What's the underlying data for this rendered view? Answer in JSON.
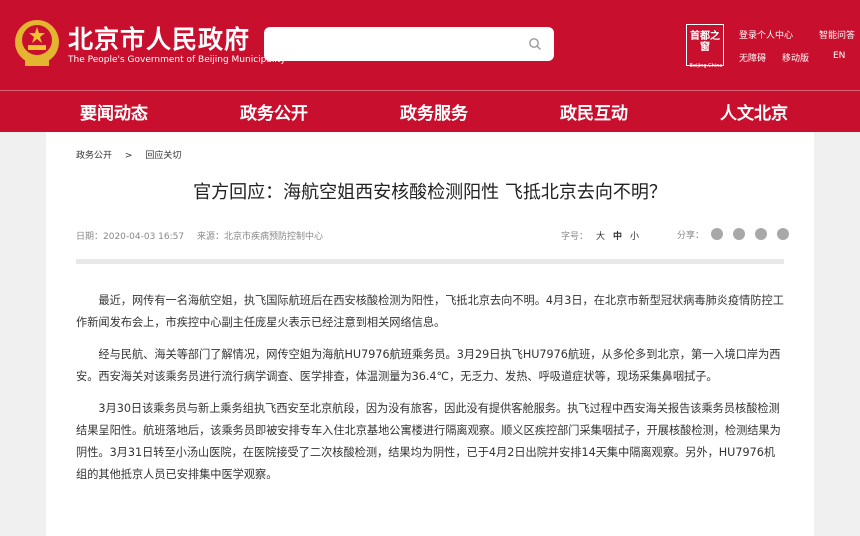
{
  "header": {
    "site_title": "北京市人民政府",
    "site_subtitle": "The People's Government of Beijing Municipality",
    "logo_beijing_text": "首都之窗",
    "logo_beijing_sub": "Beijing.China",
    "top_links": {
      "login": "登录个人中心",
      "smart_q": "智能问答",
      "accessible": "无障碍",
      "mobile": "移动版",
      "lang": "EN"
    },
    "accent": "#c8102e"
  },
  "nav": {
    "items": [
      "要闻动态",
      "政务公开",
      "政务服务",
      "政民互动",
      "人文北京"
    ]
  },
  "breadcrumb": [
    "政务公开",
    "回应关切"
  ],
  "article": {
    "title": "官方回应：海航空姐西安核酸检测阳性 飞抵北京去向不明？",
    "date": "日期：2020-04-03 16:57",
    "source": "来源：北京市疾病预防控制中心",
    "font_label": "字号：",
    "font_options": [
      "大",
      "中",
      "小"
    ],
    "share_label": "分享：",
    "share_icons": [
      "weibo-icon",
      "wechat-icon",
      "qq-icon",
      "qzone-icon"
    ],
    "paragraphs": [
      "最近，网传有一名海航空姐，执飞国际航班后在西安核酸检测为阳性，飞抵北京去向不明。4月3日，在北京市新型冠状病毒肺炎疫情防控工作新闻发布会上，市疾控中心副主任庞星火表示已经注意到相关网络信息。",
      "经与民航、海关等部门了解情况，网传空姐为海航HU7976航班乘务员。3月29日执飞HU7976航班，从多伦多到北京，第一入境口岸为西安。西安海关对该乘务员进行流行病学调查、医学排查，体温测量为36.4℃，无乏力、发热、呼吸道症状等，现场采集鼻咽拭子。",
      "3月30日该乘务员与新上乘务组执飞西安至北京航段，因为没有旅客，因此没有提供客舱服务。执飞过程中西安海关报告该乘务员核酸检测结果呈阳性。航班落地后，该乘务员即被安排专车入住北京基地公寓楼进行隔离观察。顺义区疾控部门采集咽拭子，开展核酸检测，检测结果为阴性。3月31日转至小汤山医院，在医院接受了二次核酸检测，结果均为阴性，已于4月2日出院并安排14天集中隔离观察。另外，HU7976机组的其他抵京人员已安排集中医学观察。"
    ]
  }
}
